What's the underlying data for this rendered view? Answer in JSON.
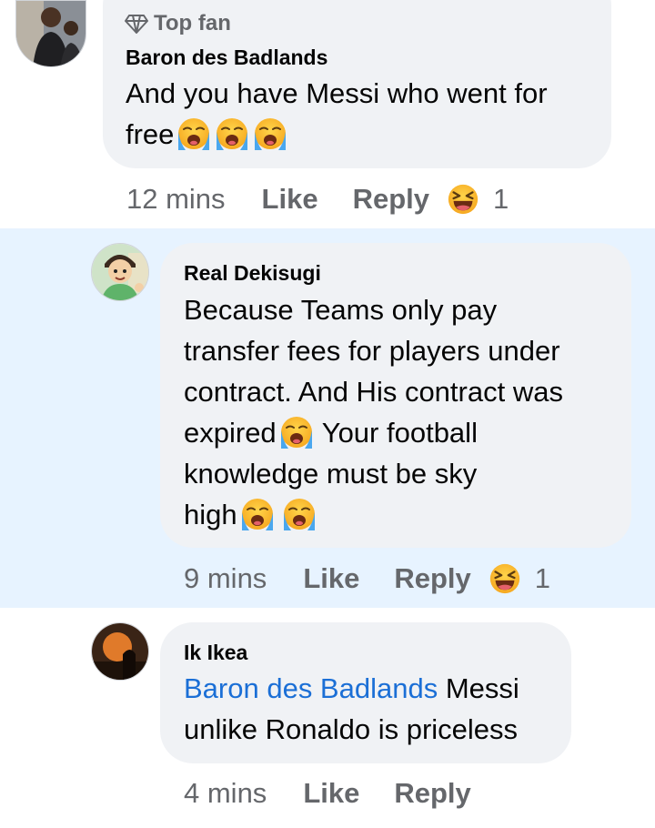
{
  "comments": [
    {
      "badge": "Top fan",
      "author": "Baron des Badlands",
      "text_lines": [
        "And you have Messi who went for",
        "free"
      ],
      "time": "12 mins",
      "like_label": "Like",
      "reply_label": "Reply",
      "reaction_count": "1"
    },
    {
      "author": "Real Dekisugi",
      "text_lines": [
        "Because Teams only pay",
        "transfer fees for players under",
        "contract. And His contract was",
        "expired",
        " Your football",
        "knowledge must be sky",
        "high"
      ],
      "time": "9 mins",
      "like_label": "Like",
      "reply_label": "Reply",
      "reaction_count": "1"
    },
    {
      "author": "Ik Ikea",
      "mention": "Baron des Badlands",
      "text_lines": [
        " Messi",
        "unlike Ronaldo is priceless"
      ],
      "time": "4 mins",
      "like_label": "Like",
      "reply_label": "Reply"
    }
  ],
  "colors": {
    "highlight_bg": "#e7f3ff",
    "bubble_bg": "#f0f2f5",
    "mention": "#1b6fd6",
    "meta_text": "#65676b"
  },
  "icons": {
    "badge": "diamond-icon",
    "emoji": "loudly-crying-face-icon",
    "reaction": "haha-reaction-icon"
  }
}
